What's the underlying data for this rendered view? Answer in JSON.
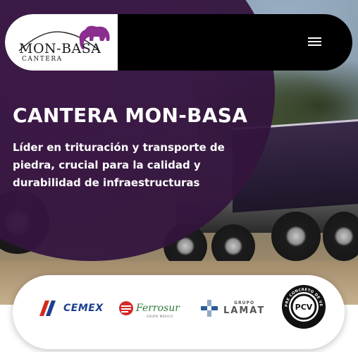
{
  "header": {
    "logo": {
      "title": "MON-BASA",
      "subtitle": "CANTERA"
    },
    "menu_icon": "hamburger-menu-icon"
  },
  "hero": {
    "title": "CANTERA MON-BASA",
    "subtitle": "Líder en trituración y transporte de piedra, crucial para la calidad y durabilidad de infraestructuras"
  },
  "partners": {
    "items": [
      {
        "name": "CEMEX",
        "label": "CEMEX"
      },
      {
        "name": "Ferrosur",
        "label": "Ferrosur",
        "tagline": "GRUPO MÉXICO"
      },
      {
        "name": "Grupo LAMAT",
        "label": "LAMAT",
        "group_label": "GRUPO"
      },
      {
        "name": "Pre Concreto de Veracruz",
        "label": "PRE CONCRETO DE VERACRUZ",
        "monogram": "PCV"
      }
    ]
  },
  "colors": {
    "purple_overlay": "#3c1646",
    "header_bg": "#000000",
    "logo_elephant": "#8a2e8f",
    "cemex_blue": "#1e3f8f",
    "cemex_red": "#d52b1e",
    "ferrosur_red": "#d42a2a",
    "ferrosur_green": "#2f7a3b",
    "lamat_blue": "#2c5d95"
  }
}
